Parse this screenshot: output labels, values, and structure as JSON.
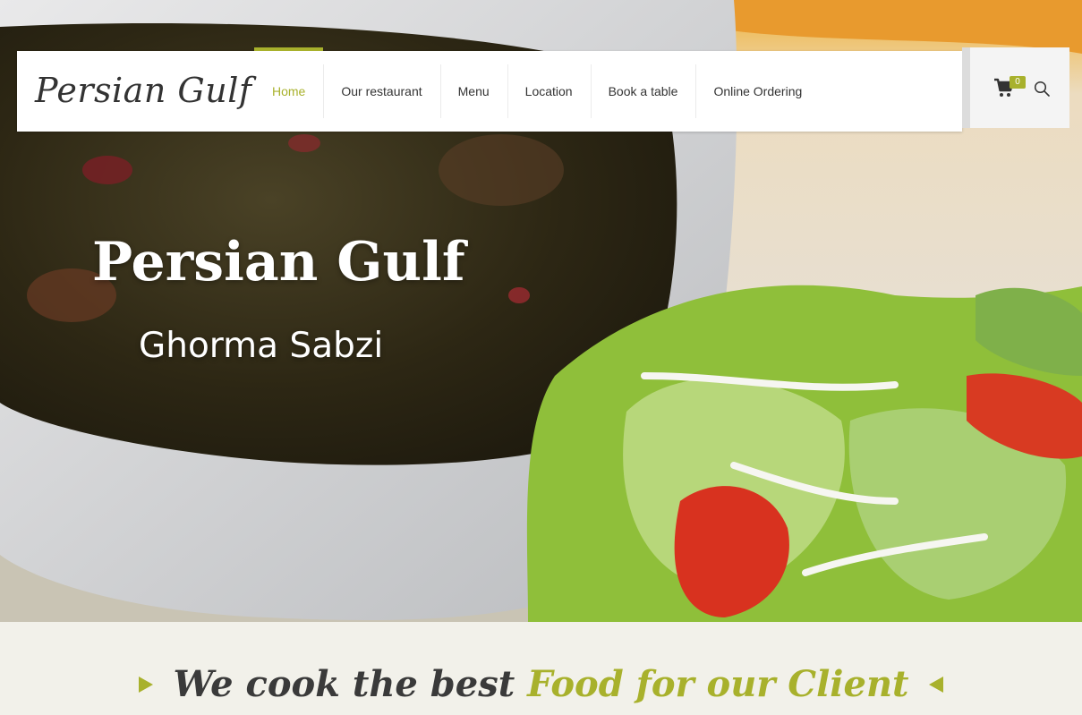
{
  "header": {
    "logo": "Persian Gulf",
    "nav": [
      {
        "label": "Home",
        "active": true
      },
      {
        "label": "Our restaurant",
        "active": false
      },
      {
        "label": "Menu",
        "active": false
      },
      {
        "label": "Location",
        "active": false
      },
      {
        "label": "Book a table",
        "active": false
      },
      {
        "label": "Online Ordering",
        "active": false
      }
    ],
    "cart_icon": "cart-icon",
    "cart_count": "0",
    "search_icon": "search-icon"
  },
  "hero": {
    "title": "Persian Gulf",
    "subtitle": "Ghorma Sabzi"
  },
  "tagline": {
    "part1": "We cook the best ",
    "part2": "Food for our Client"
  },
  "colors": {
    "accent": "#a8b12c",
    "text": "#333333",
    "section_bg": "#f2f1ea"
  }
}
